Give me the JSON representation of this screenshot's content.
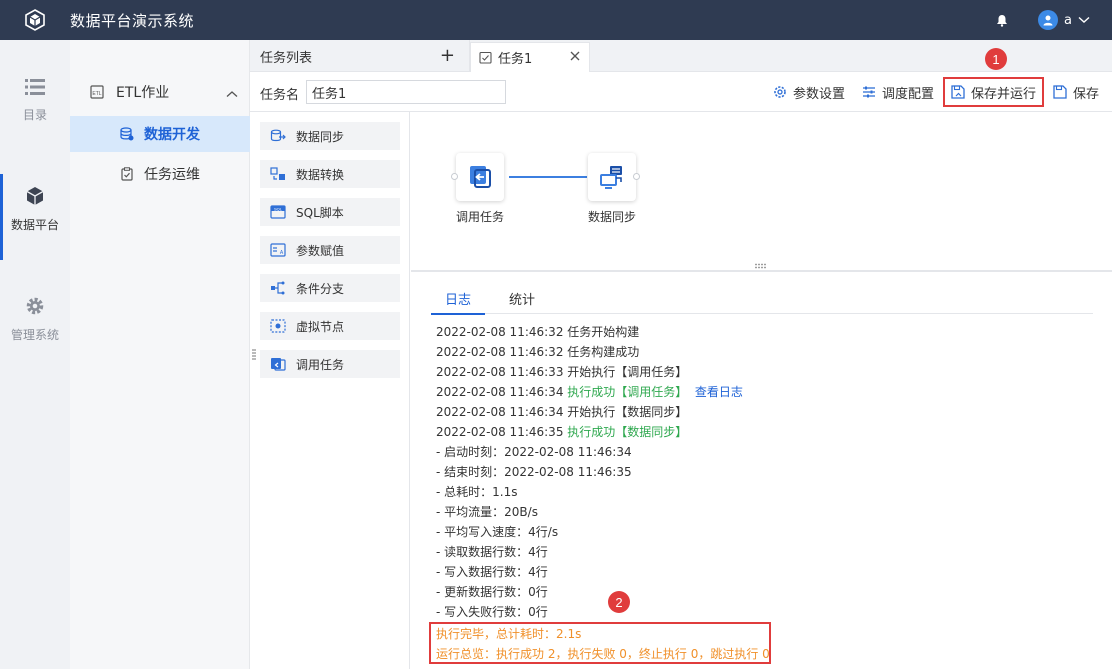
{
  "header": {
    "title": "数据平台演示系统",
    "user": "a"
  },
  "iconnav": [
    {
      "label": "目录",
      "icon": "list-icon"
    },
    {
      "label": "数据平台",
      "icon": "cube-icon"
    },
    {
      "label": "管理系统",
      "icon": "gear-icon"
    }
  ],
  "subnav": {
    "group": "ETL作业",
    "items": [
      {
        "label": "数据开发"
      },
      {
        "label": "任务运维"
      }
    ]
  },
  "tabs": {
    "list_label": "任务列表",
    "task_label": "任务1"
  },
  "toolbar": {
    "name_label": "任务名",
    "name_value": "任务1",
    "params": "参数设置",
    "schedule": "调度配置",
    "save_run": "保存并运行",
    "save": "保存"
  },
  "badges": {
    "one": "1",
    "two": "2"
  },
  "components": [
    "数据同步",
    "数据转换",
    "SQL脚本",
    "参数赋值",
    "条件分支",
    "虚拟节点",
    "调用任务"
  ],
  "canvas": {
    "node1": "调用任务",
    "node2": "数据同步"
  },
  "log": {
    "tabs": [
      "日志",
      "统计"
    ],
    "lines": {
      "l1": "2022-02-08 11:46:32 任务开始构建",
      "l2": "2022-02-08 11:46:32 任务构建成功",
      "l3": "2022-02-08 11:46:33 开始执行【调用任务】",
      "l4_prefix": "2022-02-08 11:46:34 ",
      "l4_status": "执行成功【调用任务】",
      "l4_link": "查看日志",
      "l5": "2022-02-08 11:46:34 开始执行【数据同步】",
      "l6_prefix": "2022-02-08 11:46:35 ",
      "l6_status": "执行成功【数据同步】",
      "l7": "- 启动时刻：2022-02-08 11:46:34",
      "l8": "- 结束时刻：2022-02-08 11:46:35",
      "l9": "- 总耗时：1.1s",
      "l10": "- 平均流量：20B/s",
      "l11": "- 平均写入速度：4行/s",
      "l12": "- 读取数据行数：4行",
      "l13": "- 写入数据行数：4行",
      "l14": "- 更新数据行数：0行",
      "l15": "- 写入失败行数：0行"
    },
    "summary": {
      "s1": "执行完毕，总计耗时：2.1s",
      "s2": "运行总览：执行成功 2，执行失败 0，终止执行 0，跳过执行 0"
    }
  }
}
